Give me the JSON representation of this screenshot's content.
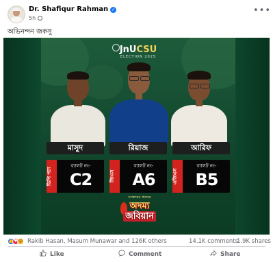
{
  "post": {
    "author": "Dr. Shafiqur Rahman",
    "time": "5h",
    "caption": "অভিনন্দন জকসু"
  },
  "poster": {
    "logo_top": "JnU",
    "logo_accent": "CSU",
    "logo_sub": "ELECTION 2025",
    "candidates": [
      {
        "name": "মাসুদ",
        "party_tag": "ভিপি পদে",
        "ballot_label": "ব্যালট নং-",
        "ballot_code": "C2"
      },
      {
        "name": "রিয়াজ",
        "party_tag": "জিএস",
        "ballot_label": "ব্যালট নং-",
        "ballot_code": "A6"
      },
      {
        "name": "আরিফ",
        "party_tag": "এজিএস",
        "ballot_label": "ব্যালট নং-",
        "ballot_code": "B5"
      }
    ],
    "badge_small": "সংস্কারের প্রত্যয়ে",
    "badge_line1": "অদম্য",
    "badge_line2": "জবিয়ান"
  },
  "stats": {
    "reactions_text": "Rakib Hasan, Masum Munawar and 126K others",
    "comments": "14.1K comments",
    "shares": "1.9K shares"
  },
  "actions": {
    "like": "Like",
    "comment": "Comment",
    "share": "Share"
  },
  "colors": {
    "poster_green": "#154c31",
    "ballot_red": "#d2231e",
    "facebook_blue": "#1877f2"
  },
  "icons": [
    "verified-icon",
    "globe-icon",
    "more-options-icon",
    "like-icon",
    "comment-icon",
    "share-icon"
  ]
}
